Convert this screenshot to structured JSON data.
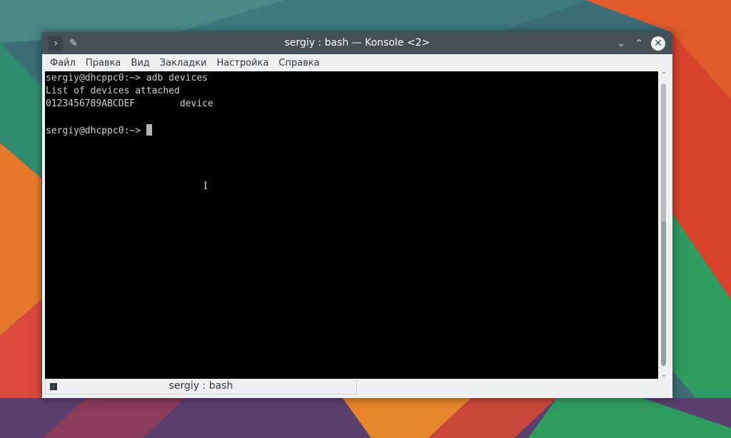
{
  "window": {
    "title": "sergiy : bash — Konsole <2>"
  },
  "menu": [
    "Файл",
    "Правка",
    "Вид",
    "Закладки",
    "Настройка",
    "Справка"
  ],
  "terminal": {
    "lines": [
      "sergiy@dhcppc0:~> adb devices",
      "List of devices attached",
      "0123456789ABCDEF        device",
      "",
      "sergiy@dhcppc0:~> "
    ]
  },
  "tab": {
    "label": "sergiy : bash"
  },
  "colors": {
    "titlebar": "#475057",
    "terminal_bg": "#000000",
    "terminal_fg": "#d0d0d0"
  }
}
